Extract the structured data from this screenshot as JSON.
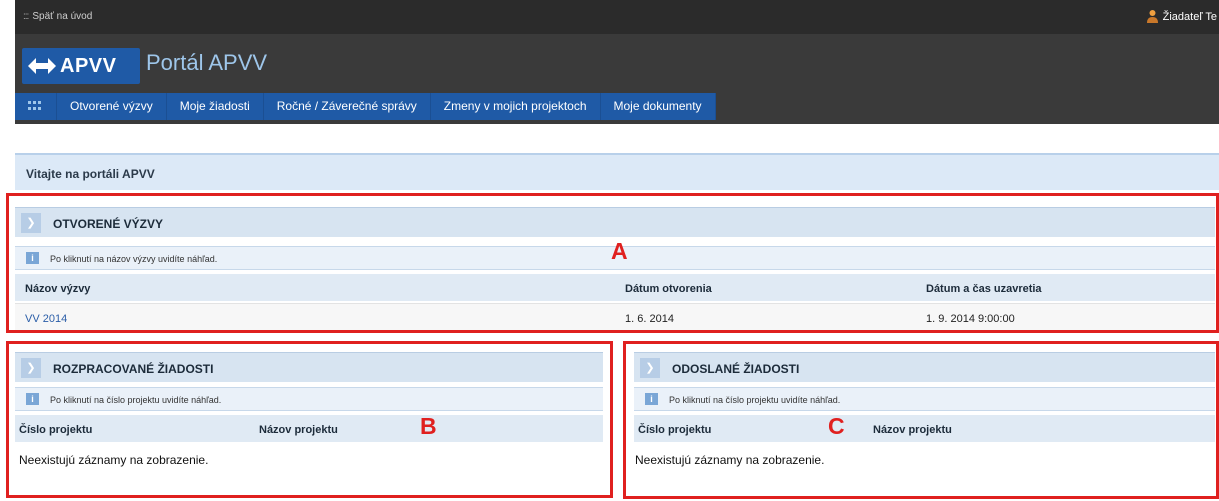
{
  "topbar": {
    "back_label": "Späť na úvod",
    "user_label": "Žiadateľ Te"
  },
  "header": {
    "logo_text": "APVV",
    "portal_title": "Portál APVV"
  },
  "nav": {
    "items": [
      "Otvorené výzvy",
      "Moje žiadosti",
      "Ročné / Záverečné správy",
      "Zmeny v mojich projektoch",
      "Moje dokumenty"
    ]
  },
  "welcome": {
    "title": "Vitajte na portáli APVV"
  },
  "open_calls": {
    "title": "OTVORENÉ VÝZVY",
    "info": "Po kliknutí na názov výzvy uvidíte náhľad.",
    "columns": [
      "Názov výzvy",
      "Dátum otvorenia",
      "Dátum a čas uzavretia"
    ],
    "rows": [
      {
        "name": "VV 2014",
        "opened": "1. 6. 2014",
        "closes": "1. 9. 2014 9:00:00"
      }
    ],
    "annotation": "A"
  },
  "drafts": {
    "title": "ROZPRACOVANÉ ŽIADOSTI",
    "info": "Po kliknutí na číslo projektu uvidíte náhľad.",
    "columns": [
      "Číslo projektu",
      "Názov projektu"
    ],
    "empty": "Neexistujú záznamy na zobrazenie.",
    "annotation": "B"
  },
  "sent": {
    "title": "ODOSLANÉ ŽIADOSTI",
    "info": "Po kliknutí na číslo projektu uvidíte náhľad.",
    "columns": [
      "Číslo projektu",
      "Názov projektu"
    ],
    "empty": "Neexistujú záznamy na zobrazenie.",
    "annotation": "C"
  },
  "colors": {
    "brand_blue": "#1f5aa6",
    "annotation_red": "#e0201f",
    "header_dark": "#3a3a3a"
  },
  "icons": [
    "grid-icon",
    "user-icon",
    "chevron-right-icon",
    "info-icon",
    "apvv-arrows-icon"
  ]
}
